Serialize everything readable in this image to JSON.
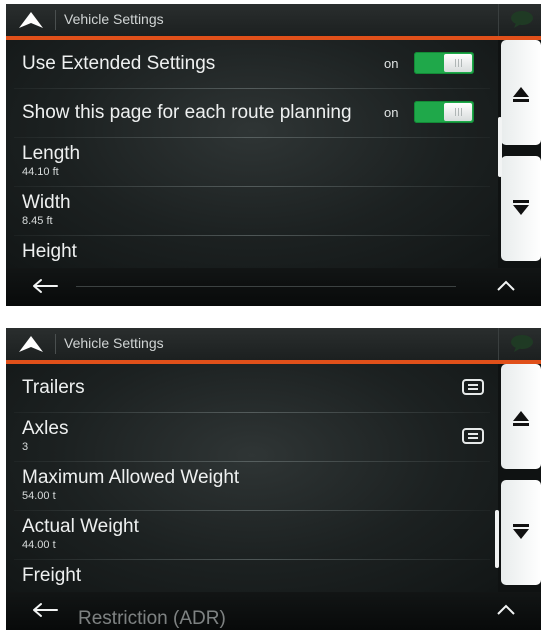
{
  "screen1": {
    "title": "Vehicle Settings",
    "rows": [
      {
        "label": "Use Extended Settings",
        "state": "on"
      },
      {
        "label": "Show this page for each route planning",
        "state": "on"
      },
      {
        "label": "Length",
        "value": "44.10 ft"
      },
      {
        "label": "Width",
        "value": "8.45 ft"
      },
      {
        "label": "Height"
      }
    ]
  },
  "screen2": {
    "title": "Vehicle Settings",
    "rows": [
      {
        "label": "Trailers"
      },
      {
        "label": "Axles",
        "value": "3"
      },
      {
        "label": "Maximum Allowed Weight",
        "value": "54.00 t"
      },
      {
        "label": "Actual Weight",
        "value": "44.00 t"
      },
      {
        "label": "Freight"
      }
    ],
    "footer_partial": "Restriction (ADR)"
  },
  "icons": {
    "header": "nav-arrow-icon",
    "message": "speech-bubble-icon",
    "back": "back-arrow-icon",
    "collapse": "caret-up-icon",
    "list": "list-icon"
  },
  "colors": {
    "accent": "#e0501a",
    "toggle_on": "#1fa84a",
    "background": "#0f1212"
  }
}
